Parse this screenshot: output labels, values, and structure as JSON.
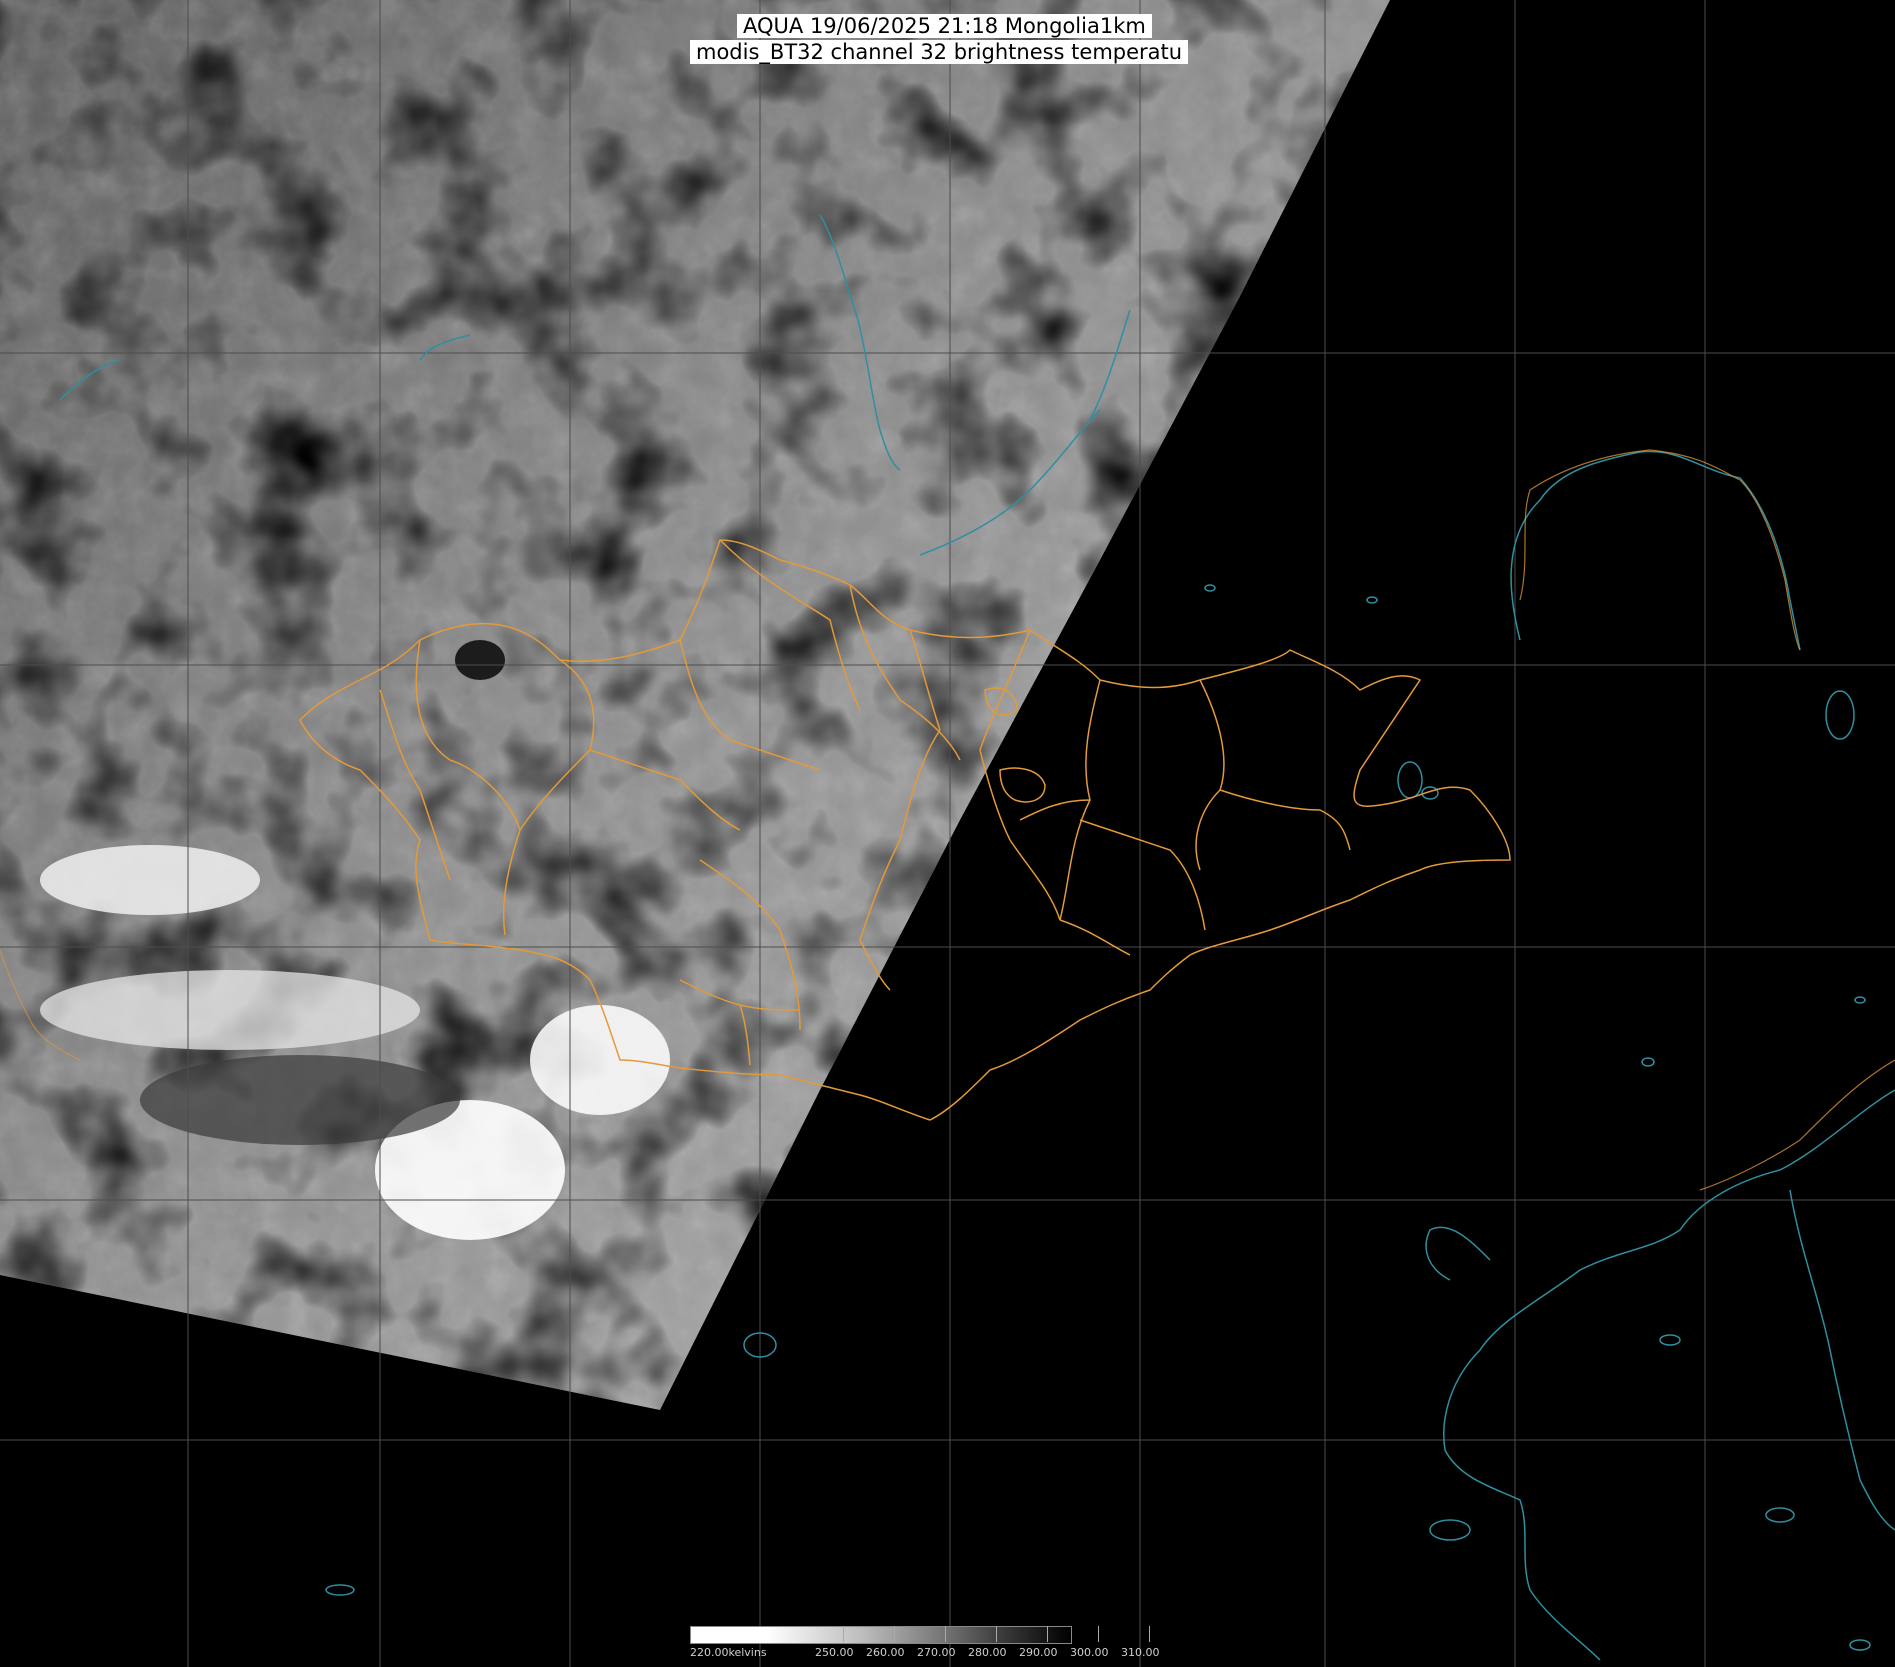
{
  "header": {
    "line1": "AQUA 19/06/2025 21:18 Mongolia1km",
    "line2": "modis_BT32 channel 32 brightness temperatu"
  },
  "colorbar": {
    "unit_label": "220.00kelvins",
    "tick_labels": [
      "250.00",
      "260.00",
      "270.00",
      "280.00",
      "290.00",
      "300.00",
      "310.00"
    ],
    "tick_values": [
      250,
      260,
      270,
      280,
      290,
      300,
      310
    ],
    "min_value": 220,
    "max_value": 320
  },
  "colors": {
    "background": "#000000",
    "grid": "#4d4d4d",
    "admin_borders": "#e39a3a",
    "coastline_rivers": "#2f8fa0",
    "title_bg": "#ffffff"
  }
}
